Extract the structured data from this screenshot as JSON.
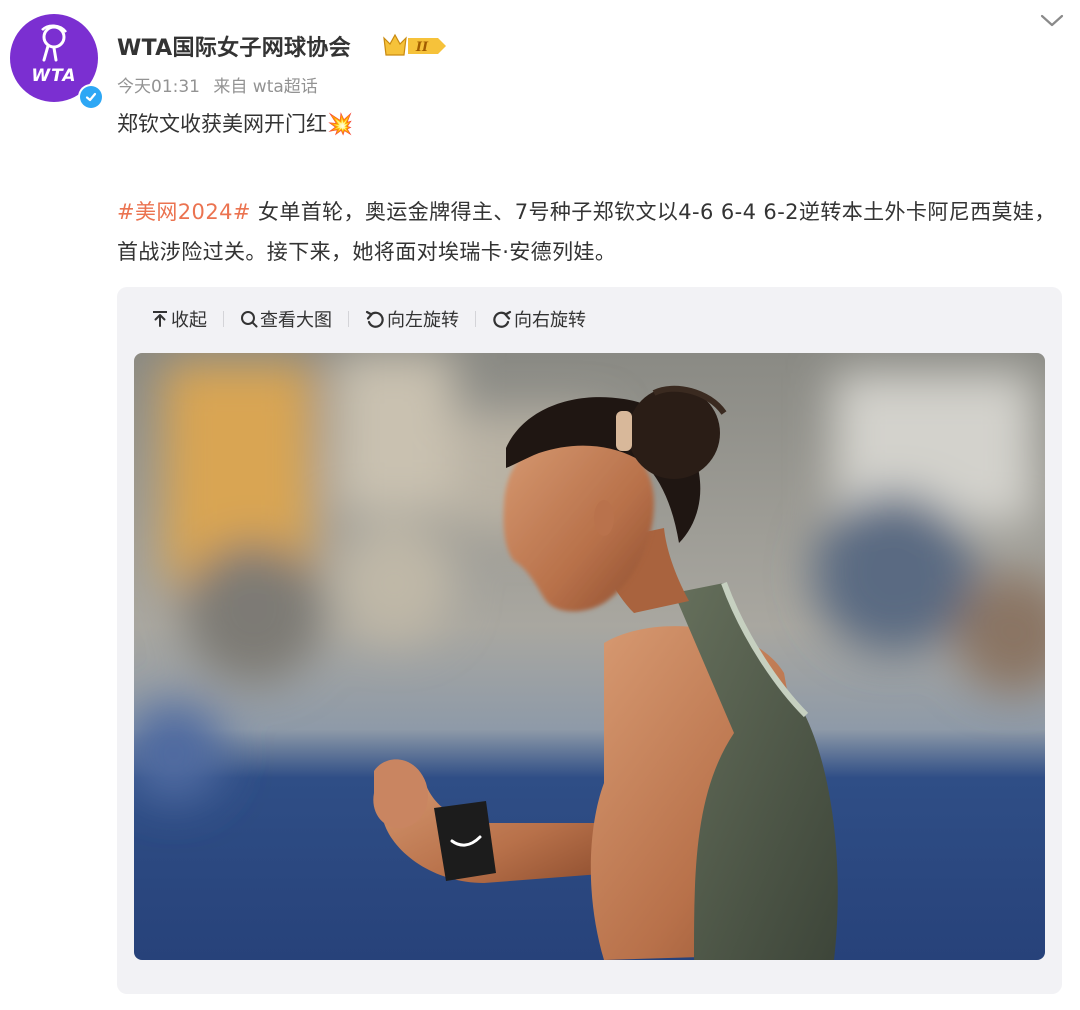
{
  "post": {
    "author": {
      "name": "WTA国际女子网球协会",
      "avatar_text": "WTA",
      "badge_roman": "II",
      "verified_icon": "verified-badge-icon",
      "badge_icon": "crown-badge-icon"
    },
    "meta": {
      "time": "今天01:31",
      "source": "来自 wta超话"
    },
    "headline": "郑钦文收获美网开门红",
    "headline_emoji": "💥",
    "hashtag": "#美网2024#",
    "body": " 女单首轮，奥运金牌得主、7号种子郑钦文以4-6 6-4 6-2逆转本土外卡阿尼西莫娃，首战涉险过关。接下来，她将面对埃瑞卡·安德列娃。"
  },
  "media_toolbar": {
    "collapse_label": "收起",
    "view_large_label": "查看大图",
    "rotate_left_label": "向左旋转",
    "rotate_right_label": "向右旋转"
  },
  "colors": {
    "hashtag": "#eb7350",
    "avatar_bg": "#7b2fd1",
    "verified": "#2da7f5",
    "badge_gold": "#f6c23a",
    "card_bg": "#f2f2f5"
  }
}
